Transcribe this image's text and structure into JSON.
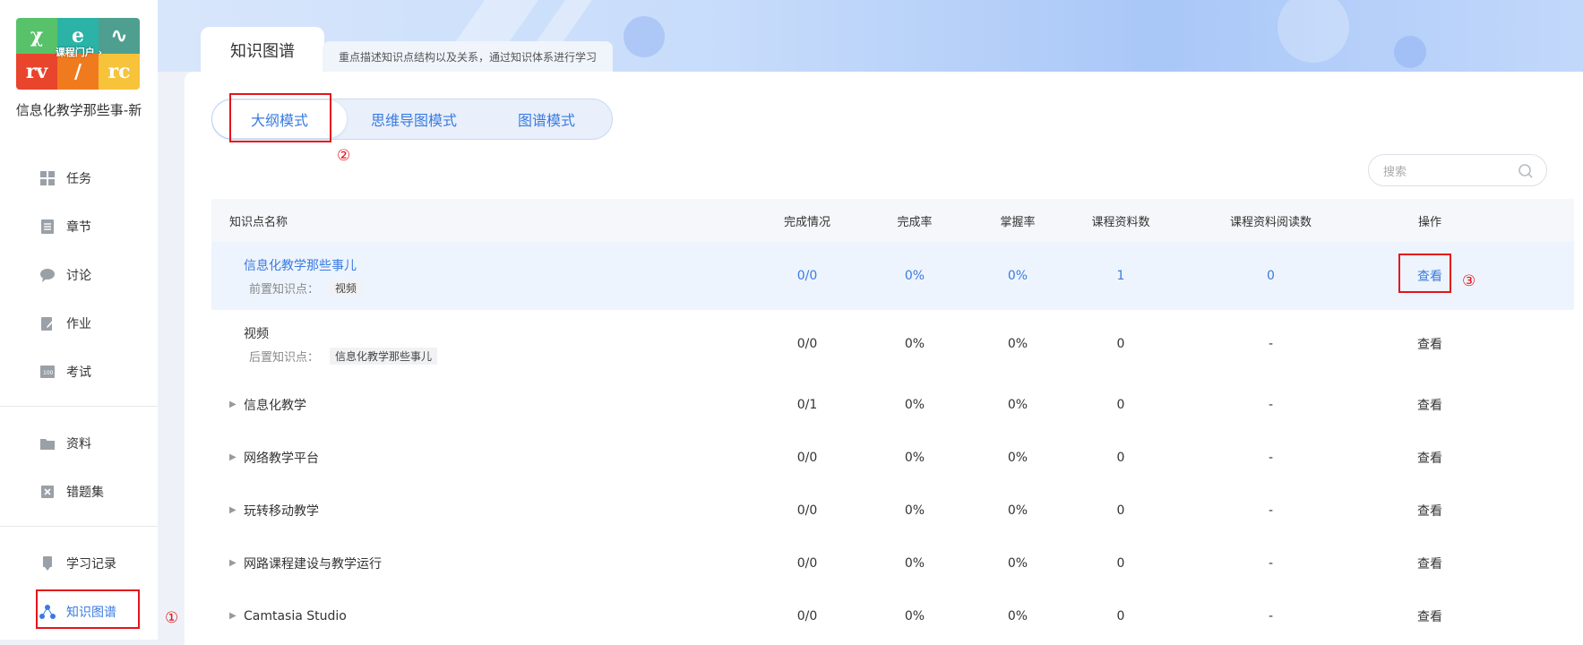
{
  "sidebar": {
    "cover_tiles": [
      {
        "glyph": "χ",
        "color": "#58c26a"
      },
      {
        "glyph": "e",
        "color": "#2ab3a6"
      },
      {
        "glyph": "∿",
        "color": "#4e9f90"
      },
      {
        "glyph": "rv",
        "color": "#e8452c"
      },
      {
        "glyph": "∕",
        "color": "#f07b1f"
      },
      {
        "glyph": "rc",
        "color": "#f6c33a"
      }
    ],
    "cover_link": "课程门户 ›",
    "course_name": "信息化教学那些事-新",
    "items": [
      {
        "label": "任务",
        "icon": "grid-icon"
      },
      {
        "label": "章节",
        "icon": "list-icon"
      },
      {
        "label": "讨论",
        "icon": "chat-icon"
      },
      {
        "label": "作业",
        "icon": "edit-icon"
      },
      {
        "label": "考试",
        "icon": "exam-icon"
      },
      {
        "label": "资料",
        "icon": "folder-icon"
      },
      {
        "label": "错题集",
        "icon": "wrong-icon"
      },
      {
        "label": "学习记录",
        "icon": "record-icon"
      },
      {
        "label": "知识图谱",
        "icon": "graph-icon",
        "active": true
      }
    ]
  },
  "header": {
    "tab_title": "知识图谱",
    "tab_desc": "重点描述知识点结构以及关系，通过知识体系进行学习"
  },
  "modes": [
    {
      "label": "大纲模式",
      "active": true
    },
    {
      "label": "思维导图模式"
    },
    {
      "label": "图谱模式"
    }
  ],
  "search": {
    "placeholder": "搜索"
  },
  "table": {
    "headers": [
      "知识点名称",
      "完成情况",
      "完成率",
      "掌握率",
      "课程资料数",
      "课程资料阅读数",
      "操作"
    ],
    "rows": [
      {
        "name": "信息化教学那些事儿",
        "sub_label": "前置知识点：",
        "sub_value": "视频",
        "completion": "0/0",
        "rate": "0%",
        "mastery": "0%",
        "materials": "1",
        "reads": "0",
        "action": "查看",
        "highlight": true
      },
      {
        "name": "视频",
        "sub_label": "后置知识点：",
        "sub_value": "信息化教学那些事儿",
        "completion": "0/0",
        "rate": "0%",
        "mastery": "0%",
        "materials": "0",
        "reads": "-",
        "action": "查看"
      },
      {
        "name": "信息化教学",
        "completion": "0/1",
        "rate": "0%",
        "mastery": "0%",
        "materials": "0",
        "reads": "-",
        "action": "查看",
        "expandable": true
      },
      {
        "name": "网络教学平台",
        "completion": "0/0",
        "rate": "0%",
        "mastery": "0%",
        "materials": "0",
        "reads": "-",
        "action": "查看",
        "expandable": true
      },
      {
        "name": "玩转移动教学",
        "completion": "0/0",
        "rate": "0%",
        "mastery": "0%",
        "materials": "0",
        "reads": "-",
        "action": "查看",
        "expandable": true
      },
      {
        "name": "网路课程建设与教学运行",
        "completion": "0/0",
        "rate": "0%",
        "mastery": "0%",
        "materials": "0",
        "reads": "-",
        "action": "查看",
        "expandable": true
      },
      {
        "name": "Camtasia Studio",
        "completion": "0/0",
        "rate": "0%",
        "mastery": "0%",
        "materials": "0",
        "reads": "-",
        "action": "查看",
        "expandable": true
      }
    ]
  },
  "annotations": [
    "①",
    "②",
    "③"
  ],
  "colors": {
    "accent": "#3a7be0",
    "annotation": "#e4141b"
  }
}
